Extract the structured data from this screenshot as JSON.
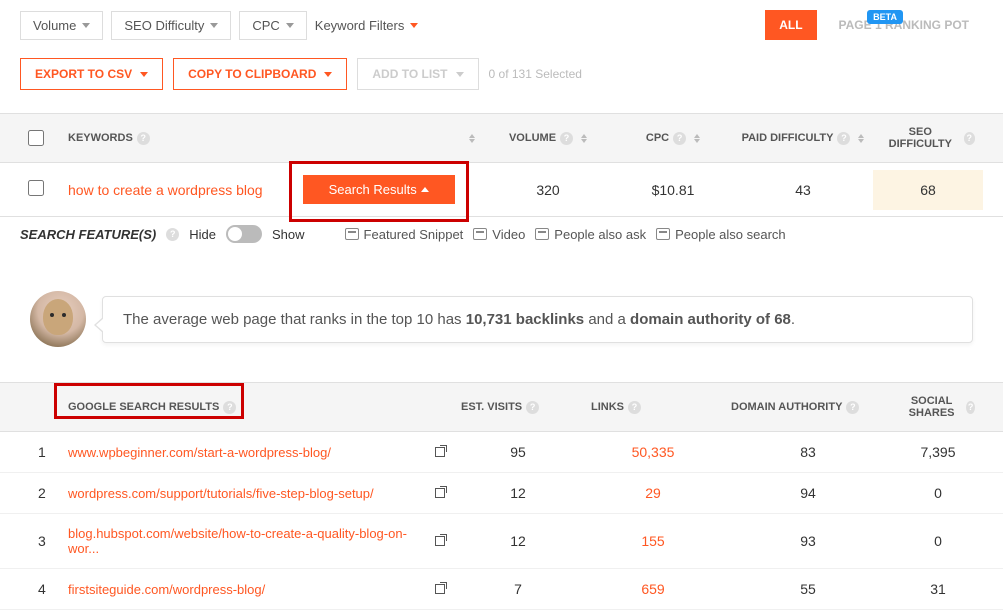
{
  "filters": {
    "volume": "Volume",
    "seo_difficulty": "SEO Difficulty",
    "cpc": "CPC",
    "keyword_filters": "Keyword Filters"
  },
  "tabs": {
    "beta": "BETA",
    "all": "ALL",
    "page1": "PAGE 1 RANKING POT"
  },
  "actions": {
    "export": "EXPORT TO CSV",
    "copy": "COPY TO CLIPBOARD",
    "add_list": "ADD TO LIST",
    "selected": "0 of 131 Selected"
  },
  "headers": {
    "keywords": "KEYWORDS",
    "volume": "VOLUME",
    "cpc": "CPC",
    "paid_diff": "PAID DIFFICULTY",
    "seo_diff": "SEO DIFFICULTY"
  },
  "row1": {
    "keyword": "how to create a wordpress blog",
    "results_btn": "Search Results",
    "volume": "320",
    "cpc": "$10.81",
    "paid_diff": "43",
    "seo_diff": "68"
  },
  "features": {
    "title": "SEARCH FEATURE(S)",
    "hide": "Hide",
    "show": "Show",
    "featured_snippet": "Featured Snippet",
    "video": "Video",
    "people_ask": "People also ask",
    "people_search": "People also search"
  },
  "insight": {
    "text_pre": "The average web page that ranks in the top 10 has ",
    "backlinks": "10,731 backlinks",
    "text_mid": " and a ",
    "domain_auth": "domain authority of 68",
    "text_end": "."
  },
  "results_headers": {
    "google": "GOOGLE SEARCH RESULTS",
    "est_visits": "EST. VISITS",
    "links": "LINKS",
    "domain_auth": "DOMAIN AUTHORITY",
    "social_shares": "SOCIAL SHARES"
  },
  "results": [
    {
      "rank": "1",
      "url": "www.wpbeginner.com/start-a-wordpress-blog/",
      "visits": "95",
      "links": "50,335",
      "da": "83",
      "shares": "7,395"
    },
    {
      "rank": "2",
      "url": "wordpress.com/support/tutorials/five-step-blog-setup/",
      "visits": "12",
      "links": "29",
      "da": "94",
      "shares": "0"
    },
    {
      "rank": "3",
      "url": "blog.hubspot.com/website/how-to-create-a-quality-blog-on-wor...",
      "visits": "12",
      "links": "155",
      "da": "93",
      "shares": "0"
    },
    {
      "rank": "4",
      "url": "firstsiteguide.com/wordpress-blog/",
      "visits": "7",
      "links": "659",
      "da": "55",
      "shares": "31"
    }
  ]
}
